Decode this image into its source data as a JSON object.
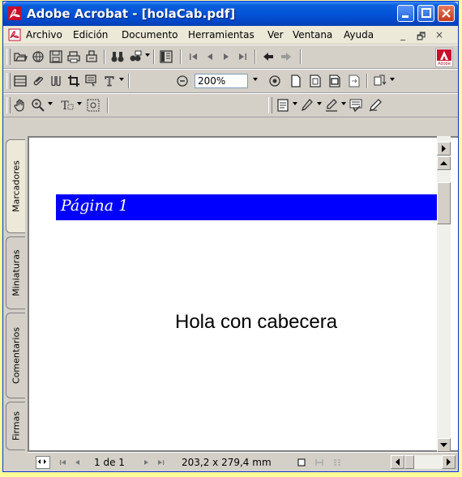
{
  "window": {
    "title": "Adobe Acrobat - [holaCab.pdf]"
  },
  "menu": {
    "items": [
      "Archivo",
      "Edición",
      "Documento",
      "Herramientas",
      "Ver",
      "Ventana",
      "Ayuda"
    ],
    "doc_minimize": "_",
    "doc_restore": "🗗",
    "doc_close": "×"
  },
  "toolbar": {
    "zoom_value": "200%",
    "text_tool_label": "T"
  },
  "sidebar": {
    "tabs": [
      "Marcadores",
      "Miniaturas",
      "Comentarios",
      "Firmas"
    ]
  },
  "document": {
    "header_text": "Página 1",
    "body_text": "Hola con cabecera",
    "header_color": "#0000ff"
  },
  "status": {
    "page_indicator": "1 de 1",
    "page_size": "203,2 x 279,4  mm"
  }
}
